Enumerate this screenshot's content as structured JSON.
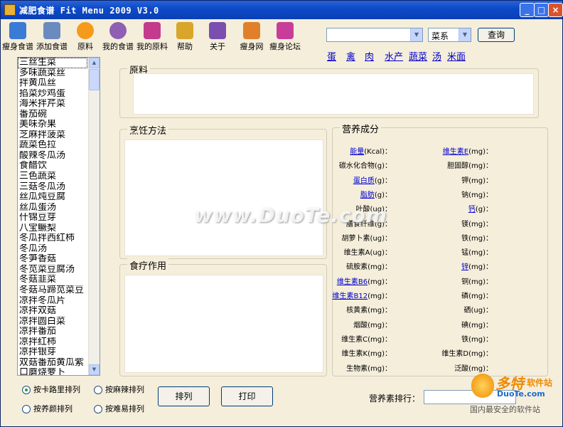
{
  "window": {
    "title": "减肥食谱 Fit Menu 2009 V3.0",
    "minimize": "_",
    "maximize": "□",
    "close": "×"
  },
  "toolbar": [
    {
      "label": "瘦身食谱",
      "icon": "calendar-icon",
      "color": "#3a7bd5"
    },
    {
      "label": "添加食谱",
      "icon": "add-recipe-icon",
      "color": "#6a8ac0"
    },
    {
      "label": "原料",
      "icon": "orange-icon",
      "color": "#f59a1a"
    },
    {
      "label": "我的食谱",
      "icon": "bowl-icon",
      "color": "#8e5fb3"
    },
    {
      "label": "我的原料",
      "icon": "box-icon",
      "color": "#c23b8d"
    },
    {
      "label": "帮助",
      "icon": "help-book-icon",
      "color": "#d9a52b"
    },
    {
      "label": "关于",
      "icon": "about-tools-icon",
      "color": "#7a4fb0"
    },
    {
      "label": "瘦身网",
      "icon": "house-icon",
      "color": "#e0802a"
    },
    {
      "label": "瘦身论坛",
      "icon": "forum-icon",
      "color": "#c93d9a"
    }
  ],
  "search": {
    "input_value": "",
    "category_value": "菜系",
    "button_label": "查询"
  },
  "categories": [
    "蛋",
    "禽",
    "肉",
    "水产",
    "蔬菜",
    "汤",
    "米面"
  ],
  "recipes": [
    "三丝生菜",
    "多味蔬菜丝",
    "拌黄瓜丝",
    "掐菜炒鸡蛋",
    "海米拌芹菜",
    "番茄碗",
    "美味杂果",
    "芝麻拌菠菜",
    "蔬菜色拉",
    "酸辣冬瓜汤",
    "食醋饮",
    "三色蔬菜",
    "三菇冬瓜汤",
    "丝瓜炖豆腐",
    "丝瓜蛋汤",
    "什锦豆芽",
    "八宝鳜梨",
    "冬瓜拌西红柿",
    "冬瓜汤",
    "冬笋香菇",
    "冬苋菜豆腐汤",
    "冬菇韭菜",
    "冬菇马蹄苋菜豆",
    "凉拌冬瓜片",
    "凉拌双菇",
    "凉拌圆白菜",
    "凉拌番茄",
    "凉拌红柿",
    "凉拌银芽",
    "双菇番茄黄瓜紫",
    "口蘑烧萝卜"
  ],
  "sections": {
    "ingredients": "原料",
    "cooking": "烹饪方法",
    "therapy": "食疗作用",
    "nutrition": "营养成分"
  },
  "nutrition_left": [
    {
      "label": "能量",
      "unit": "(Kcal)：",
      "link": true
    },
    {
      "label": "碳水化合物",
      "unit": "(g)：",
      "link": false
    },
    {
      "label": "蛋白质",
      "unit": "(g)：",
      "link": true
    },
    {
      "label": "脂肪",
      "unit": "(g)：",
      "link": true
    },
    {
      "label": "叶酸",
      "unit": "(ug)：",
      "link": false
    },
    {
      "label": "膳食纤维",
      "unit": "(g)：",
      "link": false
    },
    {
      "label": "胡萝卜素",
      "unit": "(ug)：",
      "link": false
    },
    {
      "label": "维生素A",
      "unit": "(ug)：",
      "link": false
    },
    {
      "label": "硫胺素",
      "unit": "(mg)：",
      "link": false
    },
    {
      "label": "维生素B6",
      "unit": "(mg)：",
      "link": true
    },
    {
      "label": "维生素B12",
      "unit": "(mg)：",
      "link": true
    },
    {
      "label": "核黄素",
      "unit": "(mg)：",
      "link": false
    },
    {
      "label": "烟酸",
      "unit": "(mg)：",
      "link": false
    },
    {
      "label": "维生素C",
      "unit": "(mg)：",
      "link": false
    },
    {
      "label": "维生素K",
      "unit": "(mg)：",
      "link": false
    },
    {
      "label": "生物素",
      "unit": "(mg)：",
      "link": false
    }
  ],
  "nutrition_right": [
    {
      "label": "维生素E",
      "unit": "(mg)：",
      "link": true
    },
    {
      "label": "胆固醇",
      "unit": "(mg)：",
      "link": false
    },
    {
      "label": "钾",
      "unit": "(mg)：",
      "link": false
    },
    {
      "label": "钠",
      "unit": "(mg)：",
      "link": false
    },
    {
      "label": "钙",
      "unit": "(g)：",
      "link": true
    },
    {
      "label": "镁",
      "unit": "(mg)：",
      "link": false
    },
    {
      "label": "铁",
      "unit": "(mg)：",
      "link": false
    },
    {
      "label": "锰",
      "unit": "(mg)：",
      "link": false
    },
    {
      "label": "锌",
      "unit": "(mg)：",
      "link": true
    },
    {
      "label": "铜",
      "unit": "(mg)：",
      "link": false
    },
    {
      "label": "磷",
      "unit": "(mg)：",
      "link": false
    },
    {
      "label": "硒",
      "unit": "(ug)：",
      "link": false
    },
    {
      "label": "碘",
      "unit": "(mg)：",
      "link": false
    },
    {
      "label": "铁",
      "unit": "(mg)：",
      "link": false
    },
    {
      "label": "维生素D",
      "unit": "(mg)：",
      "link": false
    },
    {
      "label": "泛酸",
      "unit": "(mg)：",
      "link": false
    }
  ],
  "sort_options": {
    "by_calorie": "按卡路里排列",
    "by_nutrition": "按养颜排列",
    "by_complexity": "按麻辣排列",
    "by_difficulty": "按难易排列",
    "selected": "by_calorie"
  },
  "buttons": {
    "sort": "排列",
    "print": "打印"
  },
  "nutrient_rank": {
    "label": "营养素排行：",
    "value": ""
  },
  "watermark": "www.DuoTe.com",
  "brand": {
    "name": "多特",
    "sub": "软件站",
    "site": "DuoTe.com",
    "slogan": "国内最安全的软件站"
  }
}
